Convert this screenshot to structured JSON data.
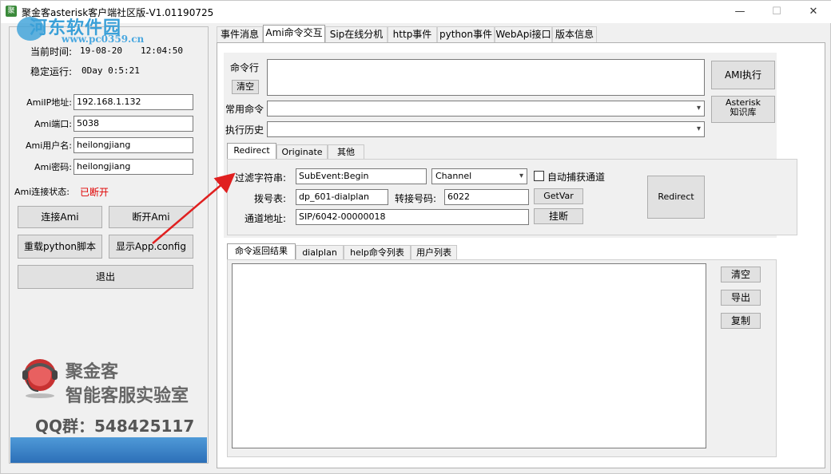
{
  "window": {
    "title": "聚金客asterisk客户端社区版-V1.01190725",
    "minimize": "—",
    "maximize": "☐",
    "close": "✕",
    "icon_text": "聚"
  },
  "watermark": {
    "name": "河东软件园",
    "url": "www.pc0359.cn"
  },
  "status": {
    "time_label": "当前时间:",
    "time_date": "19-08-20",
    "time_clock": "12:04:50",
    "uptime_label": "稳定运行:",
    "uptime_value": "0Day 0:5:21"
  },
  "connection": {
    "ip_label": "AmiIP地址:",
    "ip_value": "192.168.1.132",
    "port_label": "Ami端口:",
    "port_value": "5038",
    "user_label": "Ami用户名:",
    "user_value": "heilongjiang",
    "pwd_label": "Ami密码:",
    "pwd_value": "heilongjiang",
    "state_label": "Ami连接状态:",
    "state_value": "已断开",
    "state_color": "#e00000"
  },
  "left_buttons": {
    "connect": "连接Ami",
    "disconnect": "断开Ami",
    "reload": "重载python脚本",
    "show_config": "显示App.config",
    "exit": "退出"
  },
  "branding": {
    "company": "聚金客",
    "slogan": "智能客服实验室",
    "qq": "QQ群：548425117"
  },
  "tabs": [
    "事件消息",
    "Ami命令交互",
    "Sip在线分机",
    "http事件",
    "python事件",
    "WebApi接口",
    "版本信息"
  ],
  "command": {
    "cmd_label": "命令行",
    "clear": "清空",
    "cmd_value": "",
    "common_label": "常用命令",
    "common_value": "",
    "history_label": "执行历史",
    "history_value": "",
    "exec_button": "AMI执行",
    "kb_button_line1": "Asterisk",
    "kb_button_line2": "知识库"
  },
  "subtabs": [
    "Redirect",
    "Originate",
    "其他"
  ],
  "redirect": {
    "filter_label": "过滤字符串:",
    "filter_value": "SubEvent:Begin",
    "channel_value": "Channel",
    "autocapture_label": "自动捕获通道",
    "autocapture_checked": false,
    "dialplan_label": "拨号表:",
    "dialplan_value": "dp_601-dialplan",
    "transfer_label": "转接号码:",
    "transfer_value": "6022",
    "getvar_button": "GetVar",
    "channel_addr_label": "通道地址:",
    "channel_addr_value": "SIP/6042-00000018",
    "hangup_button": "挂断",
    "redirect_button": "Redirect"
  },
  "result_tabs": [
    "命令返回结果",
    "dialplan",
    "help命令列表",
    "用户列表"
  ],
  "result_buttons": {
    "clear": "清空",
    "export": "导出",
    "copy": "复制"
  },
  "result_text": ""
}
